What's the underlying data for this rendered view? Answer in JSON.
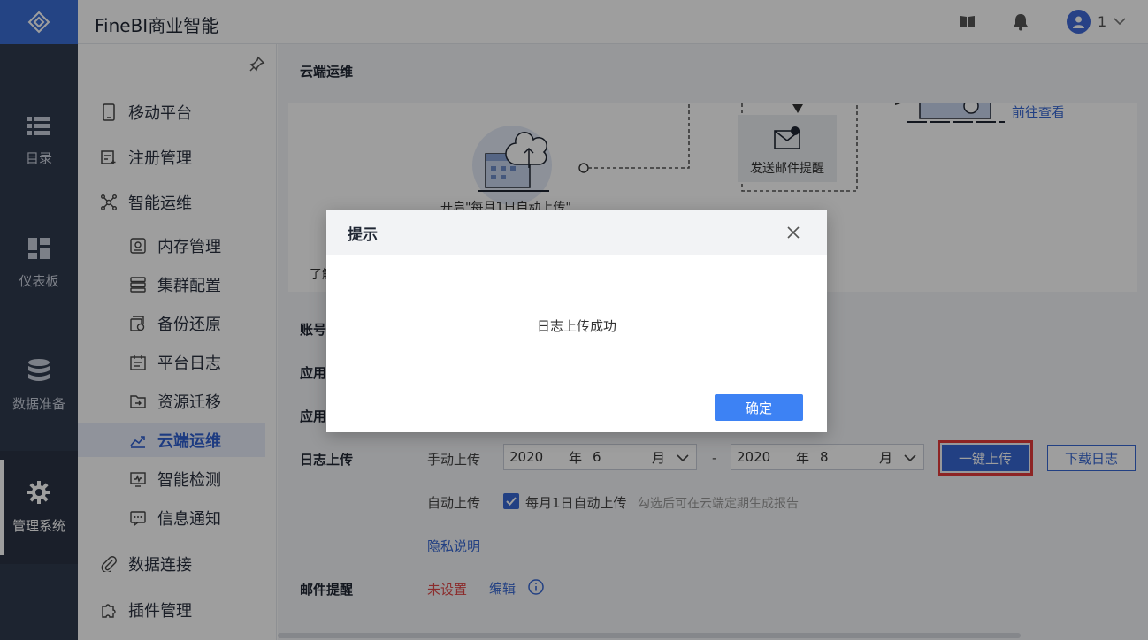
{
  "header": {
    "app_title": "FineBI商业智能",
    "user_name": "1"
  },
  "rail": {
    "items": [
      {
        "label": "目录",
        "icon": "list-icon"
      },
      {
        "label": "仪表板",
        "icon": "dashboard-icon"
      },
      {
        "label": "数据准备",
        "icon": "database-icon"
      },
      {
        "label": "管理系统",
        "icon": "gear-icon",
        "active": true
      }
    ]
  },
  "submenu": {
    "items": [
      {
        "label": "移动平台",
        "level": 1
      },
      {
        "label": "注册管理",
        "level": 1
      },
      {
        "label": "智能运维",
        "level": 1
      },
      {
        "label": "内存管理",
        "level": 2
      },
      {
        "label": "集群配置",
        "level": 2
      },
      {
        "label": "备份还原",
        "level": 2
      },
      {
        "label": "平台日志",
        "level": 2
      },
      {
        "label": "资源迁移",
        "level": 2
      },
      {
        "label": "云端运维",
        "level": 2,
        "active": true
      },
      {
        "label": "智能检测",
        "level": 2
      },
      {
        "label": "信息通知",
        "level": 2
      },
      {
        "label": "数据连接",
        "level": 1
      },
      {
        "label": "插件管理",
        "level": 1
      }
    ]
  },
  "content": {
    "title": "云端运维",
    "flow": {
      "step1": "开启\"每月1日自动上传\"",
      "step2": "发送邮件提醒",
      "step3_link": "前往查看",
      "learn_more": "了解"
    },
    "form": {
      "account_label": "账号",
      "app1_label": "应用",
      "app2_label": "应用",
      "log_upload_label": "日志上传",
      "manual_upload_label": "手动上传",
      "from": {
        "year": "2020",
        "year_unit": "年",
        "month": "6",
        "month_unit": "月"
      },
      "range_sep": "-",
      "to": {
        "year": "2020",
        "year_unit": "年",
        "month": "8",
        "month_unit": "月"
      },
      "upload_button": "一键上传",
      "download_button": "下载日志",
      "auto_upload_label": "自动上传",
      "auto_upload_option": "每月1日自动上传",
      "auto_upload_checked": true,
      "auto_upload_hint": "勾选后可在云端定期生成报告",
      "privacy_link": "隐私说明",
      "email_label": "邮件提醒",
      "email_status": "未设置",
      "email_edit": "编辑"
    }
  },
  "modal": {
    "title": "提示",
    "message": "日志上传成功",
    "ok_button": "确定"
  },
  "colors": {
    "accent": "#3768d4",
    "rail": "#303a4e",
    "highlight_border": "#e43b3b",
    "warning_text": "#e04848"
  }
}
